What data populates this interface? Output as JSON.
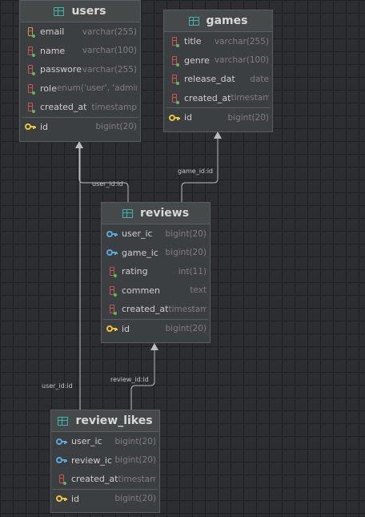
{
  "tables": {
    "users": {
      "name": "users",
      "columns": [
        {
          "name": "email",
          "type": "varchar(255)",
          "icon": "column-unique-icon"
        },
        {
          "name": "name",
          "type": "varchar(100)",
          "icon": "column-icon"
        },
        {
          "name": "passwore",
          "type": "varchar(255)",
          "icon": "column-icon"
        },
        {
          "name": "role",
          "type": "enum('user', 'admin')",
          "icon": "column-icon"
        },
        {
          "name": "created_at",
          "type": "timestamp",
          "icon": "column-icon"
        }
      ],
      "pk": {
        "name": "id",
        "type": "bigint(20)"
      }
    },
    "games": {
      "name": "games",
      "columns": [
        {
          "name": "title",
          "type": "varchar(255)",
          "icon": "column-icon"
        },
        {
          "name": "genre",
          "type": "varchar(100)",
          "icon": "column-icon"
        },
        {
          "name": "release_dat",
          "type": "date",
          "icon": "column-icon"
        },
        {
          "name": "created_at",
          "type": "timestamp",
          "icon": "column-icon"
        }
      ],
      "pk": {
        "name": "id",
        "type": "bigint(20)"
      }
    },
    "reviews": {
      "name": "reviews",
      "columns": [
        {
          "name": "user_ic",
          "type": "bigint(20)",
          "icon": "foreign-key-icon"
        },
        {
          "name": "game_ic",
          "type": "bigint(20)",
          "icon": "foreign-key-icon"
        },
        {
          "name": "rating",
          "type": "int(11)",
          "icon": "column-icon"
        },
        {
          "name": "commen",
          "type": "text",
          "icon": "column-icon"
        },
        {
          "name": "created_at",
          "type": "timestamp",
          "icon": "column-icon"
        }
      ],
      "pk": {
        "name": "id",
        "type": "bigint(20)"
      }
    },
    "review_likes": {
      "name": "review_likes",
      "columns": [
        {
          "name": "user_ic",
          "type": "bigint(20)",
          "icon": "foreign-key-icon"
        },
        {
          "name": "review_ic",
          "type": "bigint(20)",
          "icon": "foreign-key-icon"
        },
        {
          "name": "created_at",
          "type": "timestamp",
          "icon": "column-icon"
        }
      ],
      "pk": {
        "name": "id",
        "type": "bigint(20)"
      }
    }
  },
  "relations": {
    "reviews_users": "user_id:id",
    "reviews_games": "game_id:id",
    "likes_users": "user_id:id",
    "likes_reviews": "review_id:id"
  },
  "colors": {
    "background": "#2b2d30",
    "table_bg": "#3c3f41",
    "header_icon": "#3fb3a9",
    "key": "#e8c53a",
    "foreign_key": "#5ea6d6",
    "column": "#c75450"
  }
}
